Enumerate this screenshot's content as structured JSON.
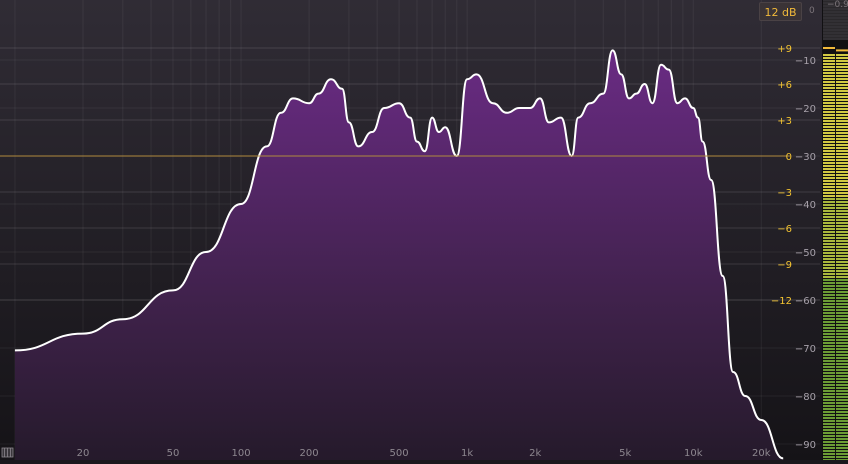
{
  "app": {
    "range_label": "12 dB",
    "meter_top_value": "0",
    "meter_peak_value": "−0.9"
  },
  "colors": {
    "background_top": "#302c35",
    "background_bottom": "#17151a",
    "fill_top": "#6a2b84",
    "fill_bottom": "#2a1932",
    "curve": "#ffffff",
    "eq_label": "#f4c431",
    "db_label": "#a7a1aa",
    "zero_line": "#b08b3e",
    "meter_green": "#6c9d35",
    "meter_yellow": "#d1c943"
  },
  "freq_axis": {
    "labels": [
      "20",
      "50",
      "100",
      "200",
      "500",
      "1k",
      "2k",
      "5k",
      "10k",
      "20k"
    ]
  },
  "eq_scale": {
    "labels": [
      "+9",
      "+6",
      "+3",
      "0",
      "−3",
      "−6",
      "−9",
      "−12"
    ]
  },
  "db_scale": {
    "labels": [
      "−10",
      "−20",
      "−30",
      "−40",
      "−50",
      "−60",
      "−70",
      "−80",
      "−90"
    ]
  },
  "spectrum": {
    "points_db": [
      [
        10,
        -70.5
      ],
      [
        20,
        -67
      ],
      [
        30,
        -64
      ],
      [
        50,
        -58
      ],
      [
        70,
        -50
      ],
      [
        100,
        -40
      ],
      [
        130,
        -28
      ],
      [
        150,
        -21
      ],
      [
        170,
        -18
      ],
      [
        200,
        -19
      ],
      [
        220,
        -17
      ],
      [
        250,
        -14
      ],
      [
        280,
        -16
      ],
      [
        300,
        -23
      ],
      [
        330,
        -28
      ],
      [
        380,
        -25
      ],
      [
        430,
        -20
      ],
      [
        500,
        -19
      ],
      [
        560,
        -22
      ],
      [
        600,
        -27
      ],
      [
        650,
        -29
      ],
      [
        700,
        -22
      ],
      [
        750,
        -25
      ],
      [
        800,
        -24
      ],
      [
        900,
        -30
      ],
      [
        1000,
        -14
      ],
      [
        1100,
        -13
      ],
      [
        1300,
        -19
      ],
      [
        1500,
        -21
      ],
      [
        1700,
        -20
      ],
      [
        1900,
        -20
      ],
      [
        2100,
        -18
      ],
      [
        2300,
        -23
      ],
      [
        2600,
        -22
      ],
      [
        2900,
        -30
      ],
      [
        3100,
        -22
      ],
      [
        3500,
        -19
      ],
      [
        4000,
        -17
      ],
      [
        4400,
        -8
      ],
      [
        4800,
        -13
      ],
      [
        5200,
        -18
      ],
      [
        5600,
        -17
      ],
      [
        6100,
        -15
      ],
      [
        6600,
        -19
      ],
      [
        7200,
        -11
      ],
      [
        7800,
        -12
      ],
      [
        8500,
        -19
      ],
      [
        9200,
        -18
      ],
      [
        10000,
        -20
      ],
      [
        10500,
        -22
      ],
      [
        11000,
        -27
      ],
      [
        12000,
        -35
      ],
      [
        13500,
        -55
      ],
      [
        15000,
        -75
      ],
      [
        17000,
        -80
      ],
      [
        20000,
        -85
      ],
      [
        25000,
        -93
      ]
    ]
  },
  "meter": {
    "peak_left_db": -0.5,
    "peak_right_db": -0.9
  }
}
